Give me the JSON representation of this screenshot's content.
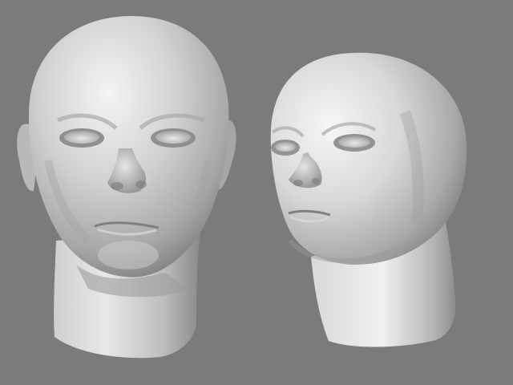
{
  "viewport": {
    "background": "#7b7b7b",
    "objects": [
      {
        "name": "head-model-frontal",
        "view": "front"
      },
      {
        "name": "head-model-three-quarter",
        "view": "three-quarter"
      }
    ],
    "colors": {
      "skin_highlight": "#f2f2f2",
      "skin_mid": "#bdbdbd",
      "skin_shadow": "#6a6a6a"
    }
  }
}
